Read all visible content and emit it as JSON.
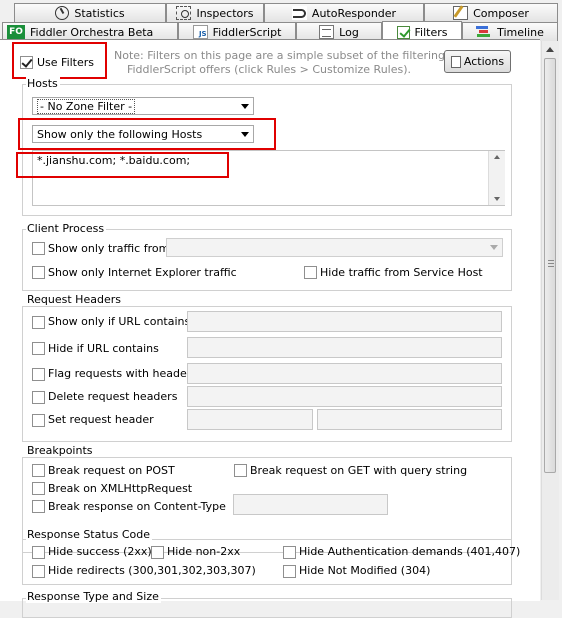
{
  "tabs": {
    "row1": [
      {
        "label": "Statistics",
        "icon": "stopwatch-icon"
      },
      {
        "label": "Inspectors",
        "icon": "inspectors-icon"
      },
      {
        "label": "AutoResponder",
        "icon": "autoresponder-icon"
      },
      {
        "label": "Composer",
        "icon": "composer-icon"
      }
    ],
    "row2": [
      {
        "label": "Fiddler Orchestra Beta",
        "icon": "fo-icon",
        "badge": "FO"
      },
      {
        "label": "FiddlerScript",
        "icon": "fiddlerscript-icon",
        "badge": "JS"
      },
      {
        "label": "Log",
        "icon": "log-icon"
      },
      {
        "label": "Filters",
        "icon": "filters-check-icon"
      },
      {
        "label": "Timeline",
        "icon": "timeline-icon"
      }
    ],
    "active": "Filters"
  },
  "top": {
    "use_filters_label": "Use Filters",
    "use_filters_checked": true,
    "note": "Note: Filters on this page are a simple subset of the filtering FiddlerScript offers (click Rules > Customize Rules).",
    "note_line1": "Note: Filters on this page are a simple subset of the filtering",
    "note_line2": "FiddlerScript offers (click Rules > Customize Rules).",
    "actions_label": "Actions"
  },
  "hosts": {
    "title": "Hosts",
    "zone_filter": "- No Zone Filter -",
    "host_filter": "Show only the following Hosts",
    "host_list": "*.jianshu.com; *.baidu.com;"
  },
  "client_process": {
    "title": "Client Process",
    "show_only_traffic_from": "Show only traffic from",
    "show_only_ie": "Show only Internet Explorer traffic",
    "hide_service_host": "Hide traffic from Service Host"
  },
  "request_headers": {
    "title": "Request Headers",
    "show_if_url": "Show only if URL contains",
    "hide_if_url": "Hide if URL contains",
    "flag_requests": "Flag requests with headers",
    "delete_headers": "Delete request headers",
    "set_header": "Set request header"
  },
  "breakpoints": {
    "title": "Breakpoints",
    "break_post": "Break request on POST",
    "break_get": "Break request on GET with query string",
    "break_xhr": "Break on XMLHttpRequest",
    "break_content_type": "Break response on Content-Type"
  },
  "response_status": {
    "title": "Response Status Code",
    "hide_success": "Hide success (2xx)",
    "hide_non2xx": "Hide non-2xx",
    "hide_auth": "Hide Authentication demands (401,407)",
    "hide_redirects": "Hide redirects (300,301,302,303,307)",
    "hide_not_modified": "Hide Not Modified (304)"
  },
  "response_type": {
    "title": "Response Type and Size"
  },
  "colors": {
    "highlight": "#e00000",
    "fo_green": "#1a8f3a"
  }
}
